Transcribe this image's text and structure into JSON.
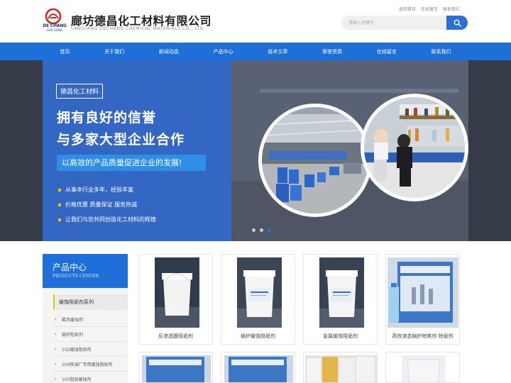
{
  "header": {
    "logo_en_1": "DE CHANG",
    "logo_en_2": "HUA GONG",
    "brand_cn": "廊坊德昌化工材料有限公司",
    "brand_en": "LANGFANG DECHANG CHEMICAL MATERIALS CO., LTD",
    "top_links": [
      "返回首页",
      "在线留言",
      "联系我们"
    ],
    "search_placeholder": "请输入关键字"
  },
  "nav": {
    "items": [
      "首页",
      "关于我们",
      "新闻动态",
      "产品中心",
      "技术文章",
      "荣誉资质",
      "在线留言",
      "联系我们"
    ]
  },
  "banner": {
    "tag": "德昌化工材料",
    "headline_1": "拥有良好的信誉",
    "headline_2": "与多家大型企业合作",
    "slogan": "以高效的产品质量促进企业的发展!",
    "bullets": [
      "从事本行业多年，经验丰富",
      "价格优惠 质量保证 服务热诚",
      "让我们与您共同创造化工材料的辉煌"
    ],
    "active_slide": 3,
    "slide_count": 3
  },
  "sidebar": {
    "title": "产品中心",
    "subtitle": "PRODUCTS CENTER",
    "category": "缓蚀阻垢剂系列",
    "items": [
      "酸洗缓蚀剂",
      "锅炉阻垢剂",
      "102缓蚀阻垢剂",
      "104炼油厂专用缓蚀阻垢剂",
      "103阻垢缓蚀剂"
    ]
  },
  "products": [
    {
      "name": "反渗透膜阻垢剂"
    },
    {
      "name": "锅炉缓蚀阻垢剂"
    },
    {
      "name": "金属缓蚀阻垢剂"
    },
    {
      "name": "高效液态锅炉除焦剂 除垢剂"
    }
  ],
  "colors": {
    "brand_blue": "#1f6fd8",
    "accent_yellow": "#f2c200",
    "logo_red": "#d0261c"
  }
}
